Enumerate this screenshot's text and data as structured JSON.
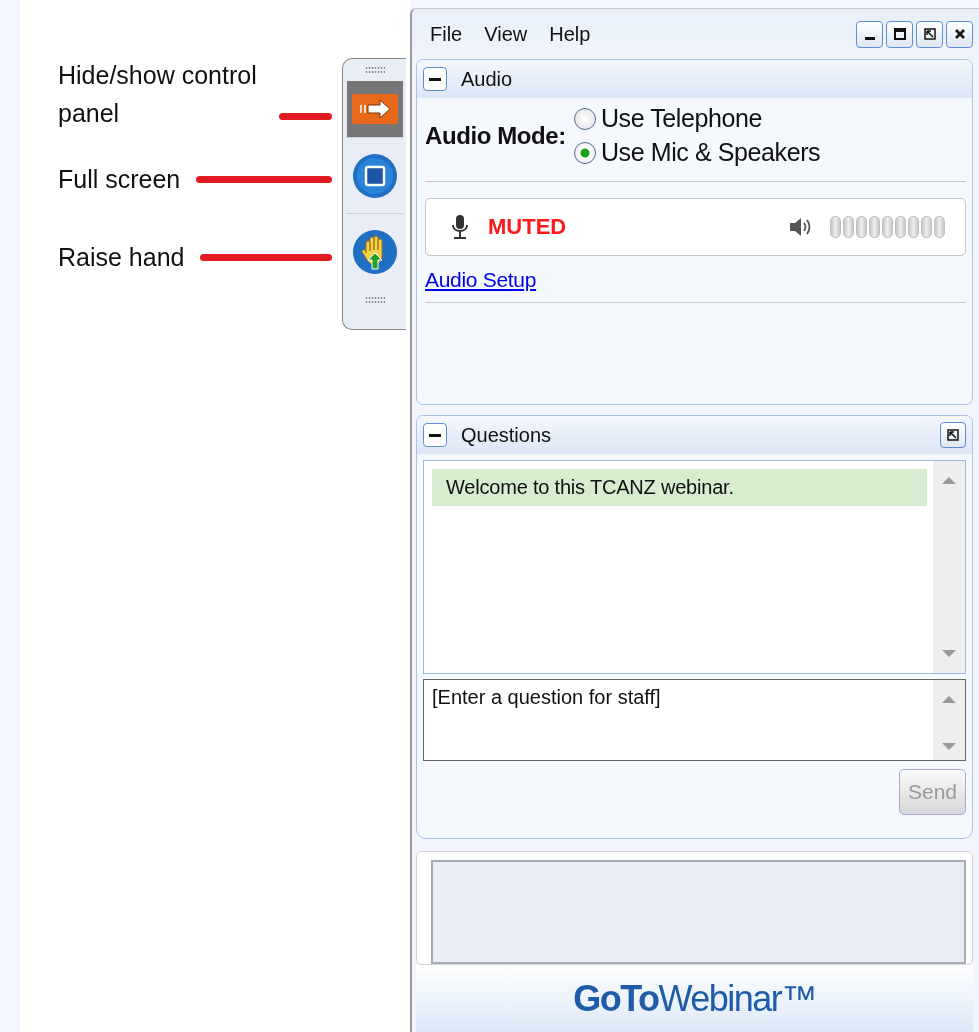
{
  "annotations": [
    {
      "label": "Hide/show control panel"
    },
    {
      "label": "Full screen"
    },
    {
      "label": "Raise hand"
    }
  ],
  "control_strip": {
    "buttons": [
      {
        "kind": "panel-toggle",
        "selected": true
      },
      {
        "kind": "fullscreen",
        "selected": false
      },
      {
        "kind": "raise-hand",
        "selected": false
      }
    ]
  },
  "menu": [
    "File",
    "View",
    "Help"
  ],
  "audio": {
    "title": "Audio",
    "mode_label": "Audio Mode:",
    "options": [
      {
        "label": "Use Telephone",
        "selected": false
      },
      {
        "label": "Use Mic & Speakers",
        "selected": true
      }
    ],
    "mic_status": "MUTED",
    "link": "Audio Setup"
  },
  "questions": {
    "title": "Questions",
    "messages": [
      {
        "text": "Welcome to this TCANZ webinar.",
        "highlighted": true
      }
    ],
    "input": {
      "placeholder": "[Enter a question for staff]"
    },
    "send": {
      "label": "Send",
      "disabled": true
    }
  },
  "logo": "**GoTo**Webinar™"
}
